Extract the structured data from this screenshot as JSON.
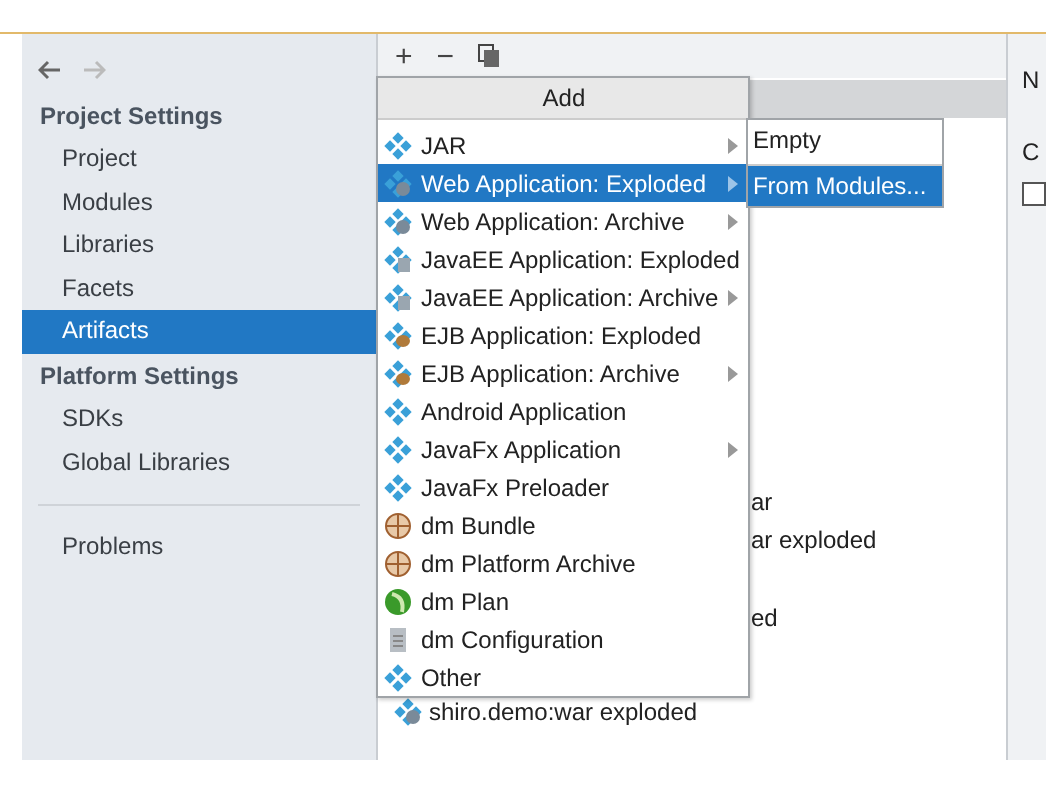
{
  "sidebar": {
    "groups": [
      {
        "title": "Project Settings",
        "items": [
          {
            "label": "Project",
            "selected": false
          },
          {
            "label": "Modules",
            "selected": false
          },
          {
            "label": "Libraries",
            "selected": false
          },
          {
            "label": "Facets",
            "selected": false
          },
          {
            "label": "Artifacts",
            "selected": true
          }
        ]
      },
      {
        "title": "Platform Settings",
        "items": [
          {
            "label": "SDKs",
            "selected": false
          },
          {
            "label": "Global Libraries",
            "selected": false
          }
        ]
      }
    ],
    "bottom_items": [
      {
        "label": "Problems",
        "selected": false
      }
    ]
  },
  "toolbar": {
    "buttons": [
      {
        "kind": "add",
        "label": "+"
      },
      {
        "kind": "remove",
        "label": "−"
      },
      {
        "kind": "copy"
      }
    ]
  },
  "tree": {
    "rows": [
      {
        "text": "ar"
      },
      {
        "text": "ar exploded"
      },
      {
        "text": "ed"
      }
    ],
    "last_row": {
      "text": "shiro.demo:war exploded"
    }
  },
  "add_menu": {
    "title": "Add",
    "items": [
      {
        "label": "JAR",
        "kind": "artifact",
        "submenu": true,
        "selected": false
      },
      {
        "label": "Web Application: Exploded",
        "kind": "web",
        "submenu": true,
        "selected": true
      },
      {
        "label": "Web Application: Archive",
        "kind": "web",
        "submenu": true,
        "selected": false
      },
      {
        "label": "JavaEE Application: Exploded",
        "kind": "javaee",
        "submenu": false,
        "selected": false
      },
      {
        "label": "JavaEE Application: Archive",
        "kind": "javaee",
        "submenu": true,
        "selected": false
      },
      {
        "label": "EJB Application: Exploded",
        "kind": "ejb",
        "submenu": false,
        "selected": false
      },
      {
        "label": "EJB Application: Archive",
        "kind": "ejb",
        "submenu": true,
        "selected": false
      },
      {
        "label": "Android Application",
        "kind": "artifact",
        "submenu": false,
        "selected": false
      },
      {
        "label": "JavaFx Application",
        "kind": "artifact",
        "submenu": true,
        "selected": false
      },
      {
        "label": "JavaFx Preloader",
        "kind": "artifact",
        "submenu": false,
        "selected": false
      },
      {
        "label": "dm Bundle",
        "kind": "bundle",
        "submenu": false,
        "selected": false
      },
      {
        "label": "dm Platform Archive",
        "kind": "bundle",
        "submenu": false,
        "selected": false
      },
      {
        "label": "dm Plan",
        "kind": "plan",
        "submenu": false,
        "selected": false
      },
      {
        "label": "dm Configuration",
        "kind": "config",
        "submenu": false,
        "selected": false
      },
      {
        "label": "Other",
        "kind": "artifact",
        "submenu": false,
        "selected": false
      }
    ]
  },
  "submenu": {
    "items": [
      {
        "label": "Empty",
        "selected": false
      },
      {
        "label": "From Modules...",
        "selected": true
      }
    ]
  },
  "right_panel": {
    "label_1": "N",
    "label_2": "C",
    "checkbox": {
      "checked": false
    }
  }
}
